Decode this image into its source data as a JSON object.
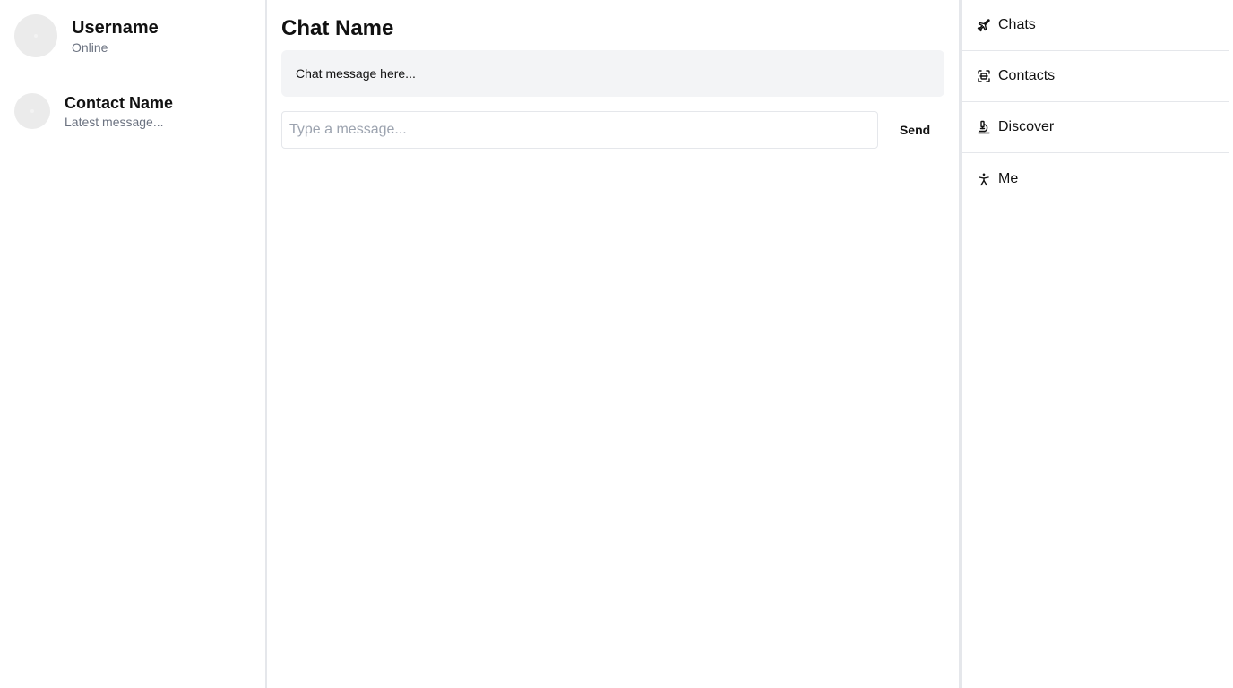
{
  "sidebar": {
    "profile": {
      "name": "Username",
      "status": "Online"
    },
    "contacts": [
      {
        "name": "Contact Name",
        "latest": "Latest message..."
      }
    ]
  },
  "chat": {
    "title": "Chat Name",
    "messages": [
      {
        "text": "Chat message here..."
      }
    ],
    "composer": {
      "placeholder": "Type a message...",
      "value": "",
      "send_label": "Send"
    }
  },
  "nav": {
    "items": [
      {
        "label": "Chats",
        "icon": "plane-icon"
      },
      {
        "label": "Contacts",
        "icon": "scan-icon"
      },
      {
        "label": "Discover",
        "icon": "microscope-icon"
      },
      {
        "label": "Me",
        "icon": "person-icon"
      }
    ]
  },
  "colors": {
    "border": "#e5e7eb",
    "message_bg": "#f3f4f6",
    "muted_text": "#6b7280",
    "avatar": "#ebebeb"
  }
}
